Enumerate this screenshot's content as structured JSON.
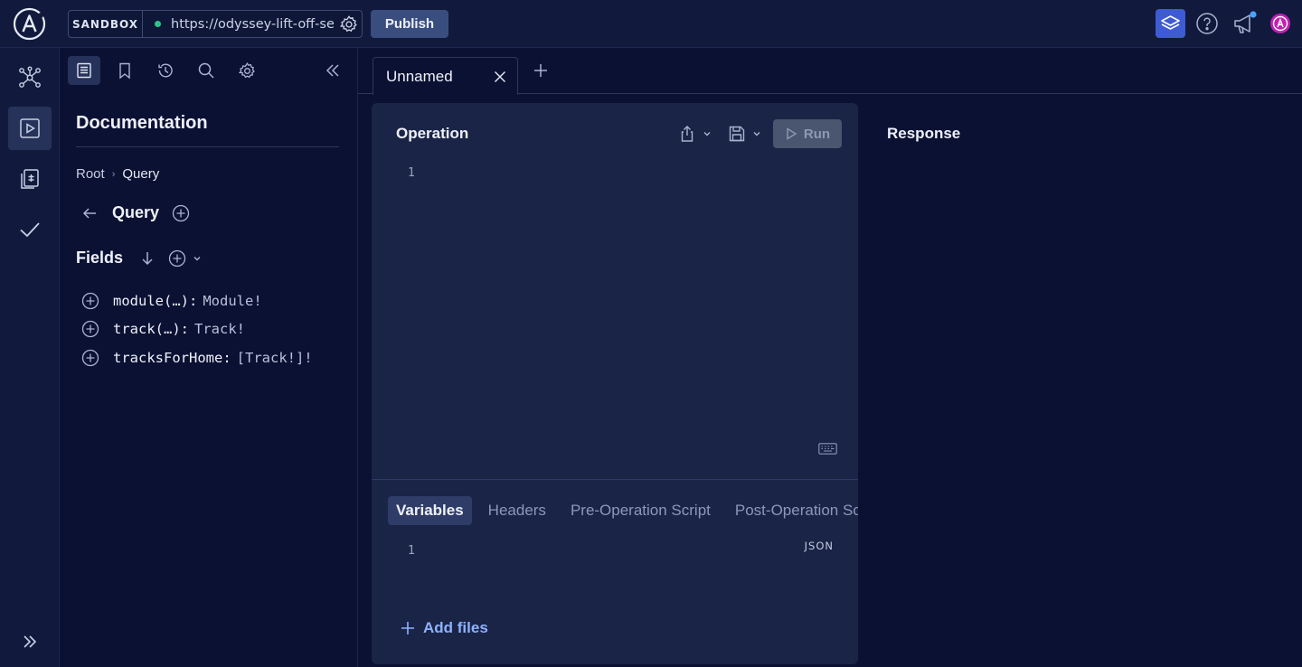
{
  "header": {
    "sandbox_label": "SANDBOX",
    "endpoint_url": "https://odyssey-lift-off-server",
    "publish_label": "Publish",
    "avatar_initial": "A"
  },
  "colors": {
    "background": "#0b1132",
    "panel": "#1a2446",
    "accent": "#3f5bd1",
    "status_ok": "#2fc38a",
    "link": "#8fb2ff"
  },
  "left_nav": {
    "items": [
      {
        "icon": "schema-graph-icon"
      },
      {
        "icon": "explorer-play-icon",
        "active": true
      },
      {
        "icon": "checks-document-icon"
      },
      {
        "icon": "checkmark-icon"
      }
    ],
    "expand_icon": "double-chevron-right-icon"
  },
  "docs": {
    "toolbar_icons": [
      "documentation-icon",
      "bookmark-icon",
      "history-icon",
      "search-icon",
      "gear-icon",
      "collapse-icon"
    ],
    "title": "Documentation",
    "breadcrumb": {
      "root": "Root",
      "separator": "›",
      "current": "Query"
    },
    "type_title": "Query",
    "fields_label": "Fields",
    "fields": [
      {
        "name": "module(…):",
        "type": "Module!"
      },
      {
        "name": "track(…):",
        "type": "Track!"
      },
      {
        "name": "tracksForHome:",
        "type": "[Track!]!"
      }
    ]
  },
  "tabs": [
    {
      "label": "Unnamed",
      "active": true
    }
  ],
  "operation": {
    "title": "Operation",
    "run_label": "Run",
    "line_number": "1",
    "sub_tabs": [
      "Variables",
      "Headers",
      "Pre-Operation Script",
      "Post-Operation Scr"
    ],
    "active_sub_tab": "Variables",
    "variables_line_number": "1",
    "json_label": "JSON",
    "add_files_label": "Add files"
  },
  "response": {
    "title": "Response"
  }
}
